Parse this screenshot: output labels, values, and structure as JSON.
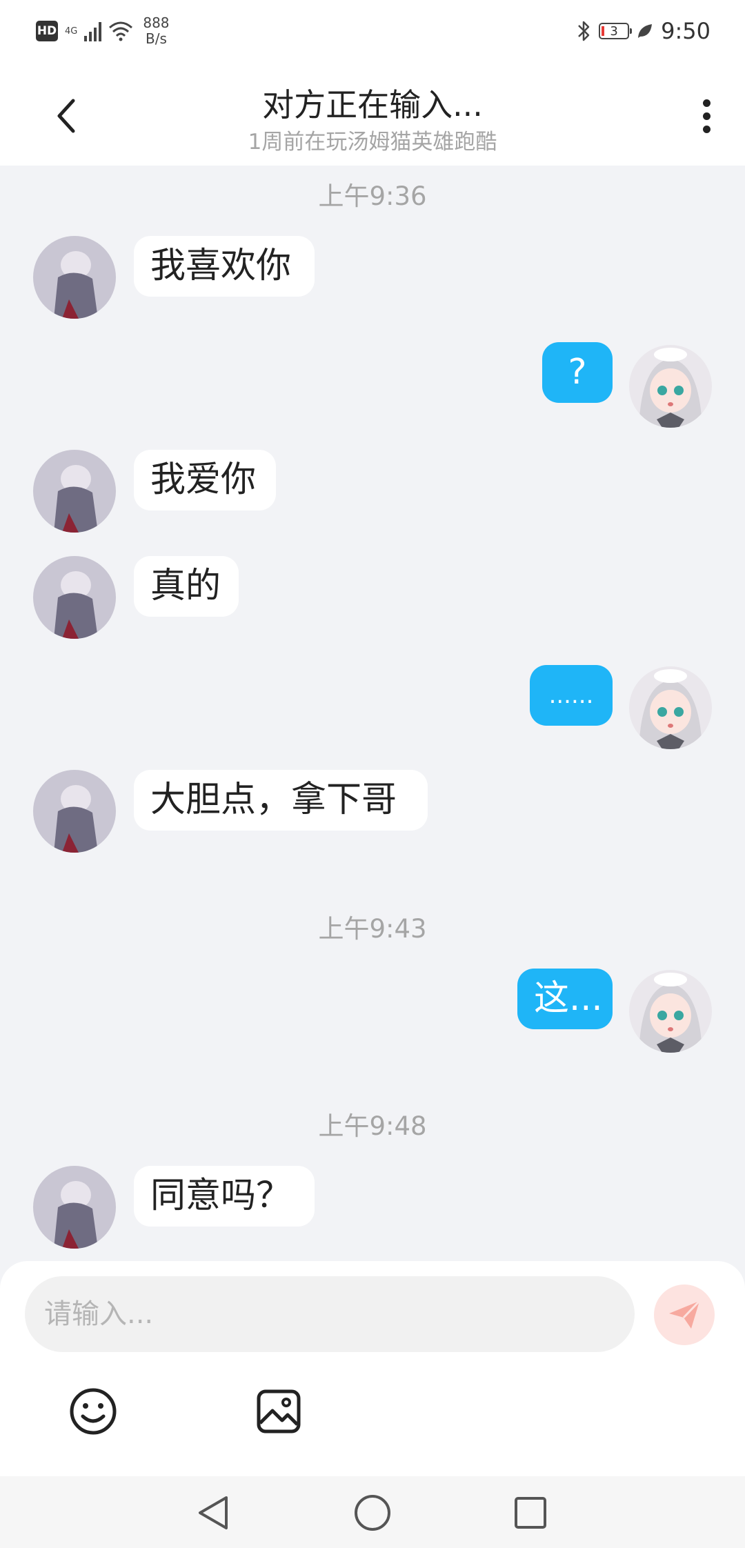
{
  "status_bar": {
    "hd": "HD",
    "network": "4G",
    "speed_value": "888",
    "speed_unit": "B/s",
    "battery": "3",
    "time": "9:50"
  },
  "header": {
    "title": "对方正在输入...",
    "subtitle": "1周前在玩汤姆猫英雄跑酷"
  },
  "messages": {
    "ts1": "上午9:36",
    "m1": "我喜欢你",
    "m2": "?",
    "m3": "我爱你",
    "m4": "真的",
    "m5": "......",
    "m6": "大胆点，拿下哥",
    "ts2": "上午9:43",
    "m7": "这...",
    "ts3": "上午9:48",
    "m8": "同意吗？"
  },
  "input": {
    "placeholder": "请输入..."
  },
  "colors": {
    "outgoing_bubble": "#1fb5f7",
    "incoming_bubble": "#ffffff",
    "chat_background": "#f2f3f6",
    "send_button": "#fde3e0",
    "send_icon": "#f7a99f"
  },
  "icons": {
    "back": "chevron-left-icon",
    "more": "more-vertical-icon",
    "send": "paper-plane-icon",
    "emoji": "smiley-icon",
    "image": "image-icon",
    "nav_back": "triangle-back-icon",
    "nav_home": "circle-home-icon",
    "nav_recent": "square-recent-icon"
  }
}
